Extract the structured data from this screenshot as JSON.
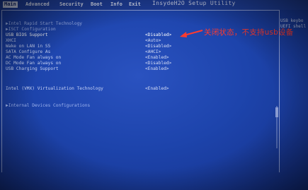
{
  "title": "InsydeH2O Setup Utility",
  "tabs": [
    {
      "label": "Main",
      "active": true
    },
    {
      "label": "Advanced",
      "active": false
    },
    {
      "label": "Security",
      "active": false
    },
    {
      "label": "Boot",
      "active": false
    },
    {
      "label": "Info",
      "active": false
    },
    {
      "label": "Exit",
      "active": false
    }
  ],
  "rows": [
    {
      "label": "▶Intel Rapid Start Technology",
      "value": ""
    },
    {
      "label": "▶ISCT Configuration",
      "value": ""
    },
    {
      "label": "USB BIOS Support",
      "value": "<Disabled>"
    },
    {
      "label": "XHCI",
      "value": "<Auto>"
    },
    {
      "label": "Wake on LAN in S5",
      "value": "<Disabled>"
    },
    {
      "label": "SATA Configure As",
      "value": "<AHCI>"
    },
    {
      "label": "AC Mode Fan always on",
      "value": "<Enabled>"
    },
    {
      "label": "DC Mode Fan always on",
      "value": "<Disabled>"
    },
    {
      "label": "USB Charging Support",
      "value": "<Enabled>"
    },
    {
      "label": "Intel (VMX) Virtualization Technology",
      "value": "<Enabled>"
    },
    {
      "label": "▶Internal Devices Configurations",
      "value": ""
    }
  ],
  "annotation": "关闭状态，不支持usb设备",
  "help": {
    "line1": "USB keybo",
    "line2": "UEFI shell"
  },
  "colors": {
    "annotation": "#ff3a2e",
    "background": "#1d44ac"
  }
}
